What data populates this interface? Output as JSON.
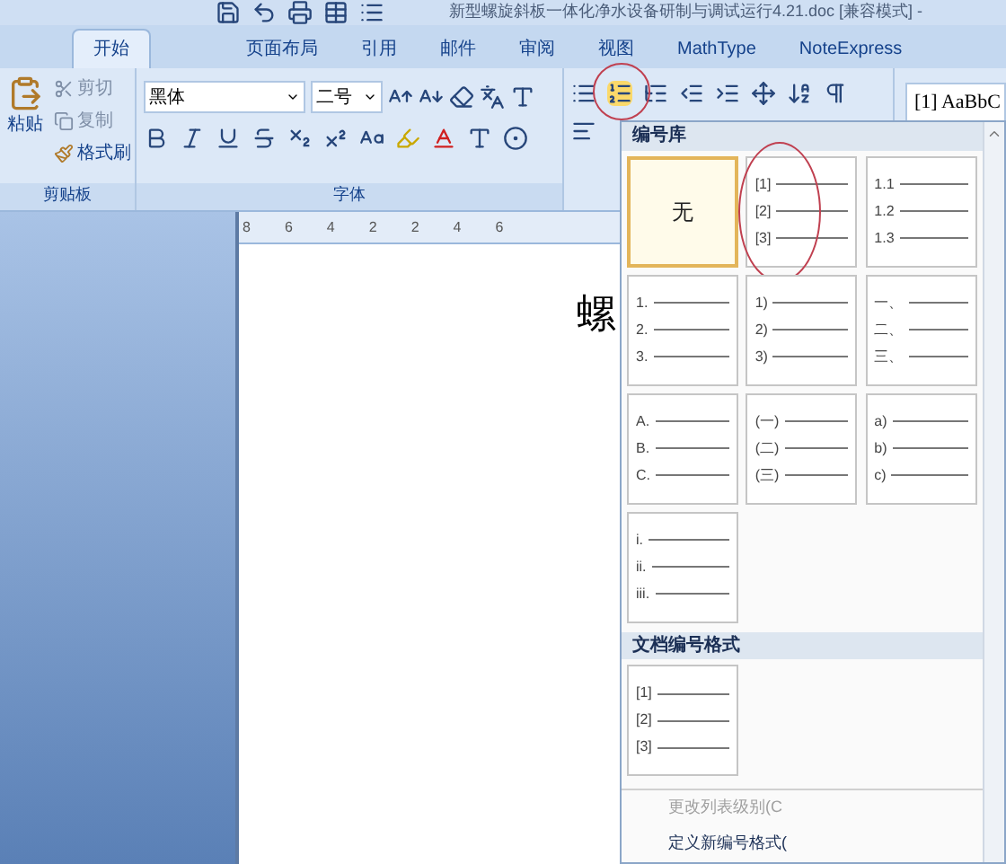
{
  "window": {
    "title": "新型螺旋斜板一体化净水设备研制与调试运行4.21.doc [兼容模式] -"
  },
  "tabs": [
    {
      "label": "开始",
      "selected": true
    },
    {
      "label": "页面布局",
      "selected": false
    },
    {
      "label": "引用",
      "selected": false
    },
    {
      "label": "邮件",
      "selected": false
    },
    {
      "label": "审阅",
      "selected": false
    },
    {
      "label": "视图",
      "selected": false
    },
    {
      "label": "MathType",
      "selected": false
    },
    {
      "label": "NoteExpress",
      "selected": false
    }
  ],
  "clipboard": {
    "paste": "粘贴",
    "cut": "剪切",
    "copy": "复制",
    "format_painter": "格式刷",
    "group_label": "剪贴板"
  },
  "font": {
    "name": "黑体",
    "size": "二号",
    "group_label": "字体"
  },
  "paragraph": {
    "numbering_circled": true
  },
  "styles": {
    "preview": "[1] AaBbC"
  },
  "ruler": {
    "labels": [
      "8",
      "6",
      "4",
      "2",
      "2",
      "4",
      "6"
    ]
  },
  "document": {
    "text": "螺"
  },
  "numbering_menu": {
    "library_title": "编号库",
    "library": [
      {
        "kind": "none",
        "label": "无",
        "selected": true,
        "circled": false
      },
      {
        "kind": "list",
        "markers": [
          "[1]",
          "[2]",
          "[3]"
        ],
        "selected": false,
        "circled": true
      },
      {
        "kind": "list",
        "markers": [
          "1.1",
          "1.2",
          "1.3"
        ],
        "selected": false,
        "circled": false
      },
      {
        "kind": "list",
        "markers": [
          "1.",
          "2.",
          "3."
        ],
        "selected": false,
        "circled": false
      },
      {
        "kind": "list",
        "markers": [
          "1)",
          "2)",
          "3)"
        ],
        "selected": false,
        "circled": false
      },
      {
        "kind": "list",
        "markers": [
          "一、",
          "二、",
          "三、"
        ],
        "selected": false,
        "circled": false
      },
      {
        "kind": "list",
        "markers": [
          "A.",
          "B.",
          "C."
        ],
        "selected": false,
        "circled": false
      },
      {
        "kind": "list",
        "markers": [
          "(一)",
          "(二)",
          "(三)"
        ],
        "selected": false,
        "circled": false
      },
      {
        "kind": "list",
        "markers": [
          "a)",
          "b)",
          "c)"
        ],
        "selected": false,
        "circled": false
      },
      {
        "kind": "list",
        "markers": [
          "i.",
          "ii.",
          "iii."
        ],
        "selected": false,
        "circled": false
      }
    ],
    "document_title": "文档编号格式",
    "document_formats": [
      {
        "kind": "list",
        "markers": [
          "[1]",
          "[2]",
          "[3]"
        ],
        "selected": false,
        "circled": false
      }
    ],
    "commands": [
      {
        "label": "更改列表级别(C",
        "disabled": true
      },
      {
        "label": "定义新编号格式(",
        "disabled": false
      }
    ]
  }
}
